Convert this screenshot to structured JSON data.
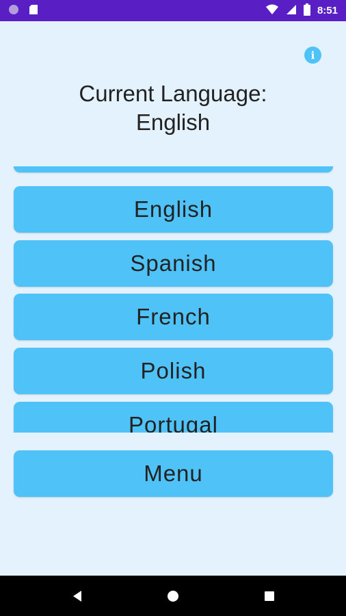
{
  "status_bar": {
    "time": "8:51",
    "icons": [
      "circle-icon",
      "sd-card-icon",
      "wifi-icon",
      "signal-icon",
      "battery-icon"
    ]
  },
  "header": {
    "info_icon": "info-icon",
    "title_line1": "Current Language:",
    "title_line2": "English"
  },
  "languages": [
    "English",
    "Spanish",
    "French",
    "Polish",
    "Portugal"
  ],
  "menu_label": "Menu",
  "nav_bar": {
    "icons": [
      "back-icon",
      "home-icon",
      "recents-icon"
    ]
  },
  "colors": {
    "status_bar": "#5a1fc4",
    "background": "#e3f2fd",
    "button": "#4fc3f7",
    "nav_bar": "#000000"
  }
}
